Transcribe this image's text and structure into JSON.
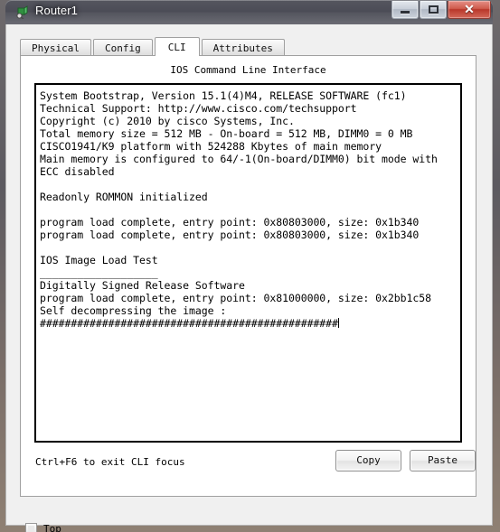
{
  "window": {
    "title": "Router1",
    "icon": "router-device-icon",
    "controls": {
      "minimize_label": "—",
      "maximize_label": "□",
      "close_label": "✕"
    }
  },
  "tabs": [
    {
      "label": "Physical",
      "active": false
    },
    {
      "label": "Config",
      "active": false
    },
    {
      "label": "CLI",
      "active": true
    },
    {
      "label": "Attributes",
      "active": false
    }
  ],
  "cli": {
    "heading": "IOS Command Line Interface",
    "console_text": "System Bootstrap, Version 15.1(4)M4, RELEASE SOFTWARE (fc1)\nTechnical Support: http://www.cisco.com/techsupport\nCopyright (c) 2010 by cisco Systems, Inc.\nTotal memory size = 512 MB - On-board = 512 MB, DIMM0 = 0 MB\nCISCO1941/K9 platform with 524288 Kbytes of main memory\nMain memory is configured to 64/-1(On-board/DIMM0) bit mode with\nECC disabled\n\nReadonly ROMMON initialized\n\nprogram load complete, entry point: 0x80803000, size: 0x1b340\nprogram load complete, entry point: 0x80803000, size: 0x1b340\n\nIOS Image Load Test\n___________________\nDigitally Signed Release Software\nprogram load complete, entry point: 0x81000000, size: 0x2bb1c58\nSelf decompressing the image :\n################################################",
    "hint": "Ctrl+F6 to exit CLI focus",
    "copy_label": "Copy",
    "paste_label": "Paste"
  },
  "footer": {
    "top_checkbox_label": "Top",
    "top_checked": false
  },
  "colors": {
    "titlebar": "#4b4c56",
    "close_button": "#b8372a",
    "client_background": "#f0f0f0",
    "terminal_background": "#ffffff",
    "terminal_text": "#000000"
  }
}
